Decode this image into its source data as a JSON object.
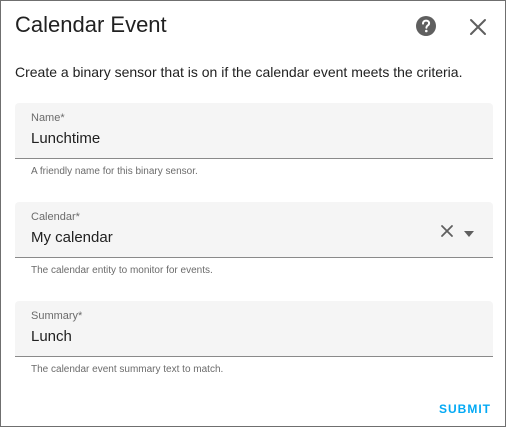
{
  "dialog": {
    "title": "Calendar Event",
    "description": "Create a binary sensor that is on if the calendar event meets the criteria."
  },
  "icons": {
    "help": "help-circle-icon",
    "close": "close-icon",
    "clear": "clear-icon",
    "dropdown": "dropdown-arrow-icon"
  },
  "fields": {
    "name": {
      "label": "Name*",
      "value": "Lunchtime",
      "helper": "A friendly name for this binary sensor."
    },
    "calendar": {
      "label": "Calendar*",
      "value": "My calendar",
      "helper": "The calendar entity to monitor for events."
    },
    "summary": {
      "label": "Summary*",
      "value": "Lunch",
      "helper": "The calendar event summary text to match."
    }
  },
  "actions": {
    "submit_label": "SUBMIT"
  },
  "colors": {
    "accent": "#03a9f4",
    "field_bg": "#f5f5f5",
    "icon": "#5f5f5f"
  }
}
